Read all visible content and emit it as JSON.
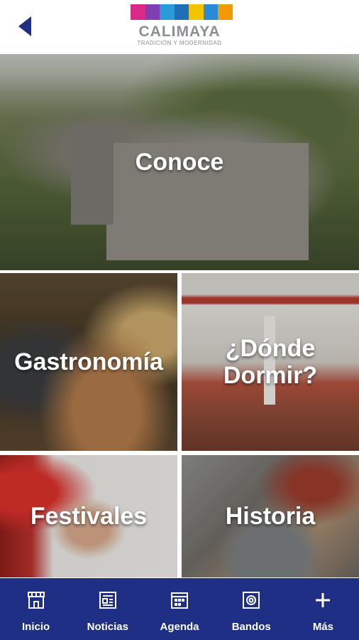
{
  "header": {
    "back_icon": "back-arrow-icon",
    "logo_name": "CALIMAYA",
    "logo_tagline": "TRADICIÓN Y MODERNIDAD",
    "logo_colors": [
      "#d92a8a",
      "#7f3fb0",
      "#2a9ad8",
      "#1f6fb8",
      "#f2c400",
      "#2b8ad6",
      "#f29a00"
    ],
    "back_color": "#1f2f86"
  },
  "tiles": [
    {
      "label": "Conoce"
    },
    {
      "label": "Gastronomía"
    },
    {
      "label": "¿Dónde Dormir?"
    },
    {
      "label": "Festivales"
    },
    {
      "label": "Historia"
    }
  ],
  "bottom_nav": {
    "background": "#1f2f86",
    "items": [
      {
        "label": "Inicio",
        "icon": "storefront-icon"
      },
      {
        "label": "Noticias",
        "icon": "newspaper-icon"
      },
      {
        "label": "Agenda",
        "icon": "calendar-icon"
      },
      {
        "label": "Bandos",
        "icon": "document-seal-icon"
      },
      {
        "label": "Más",
        "icon": "plus-icon"
      }
    ]
  }
}
